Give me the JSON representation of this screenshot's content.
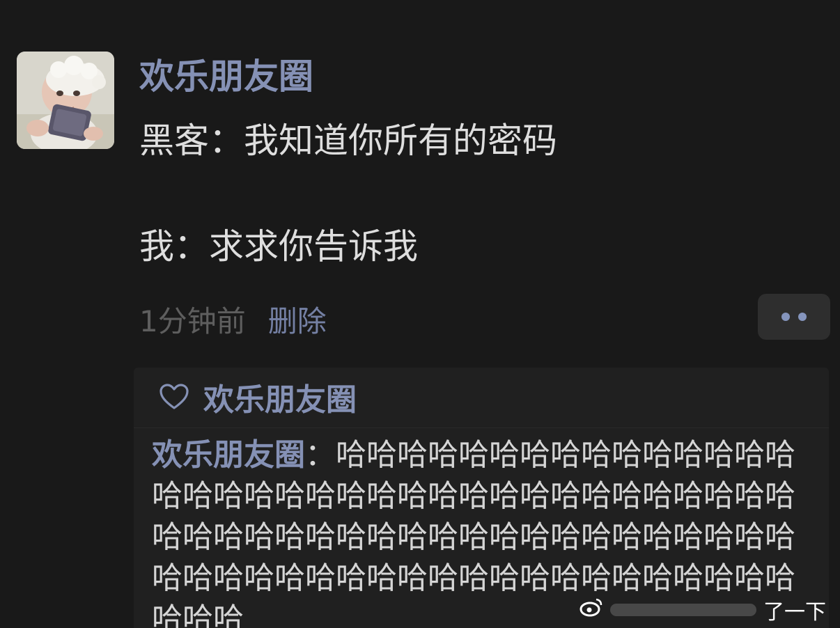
{
  "post": {
    "author": "欢乐朋友圈",
    "lines": [
      "黑客：我知道你所有的密码",
      "我：求求你告诉我"
    ],
    "timestamp": "1分钟前",
    "delete_label": "删除"
  },
  "reactions": {
    "likes": "欢乐朋友圈",
    "comment_author": "欢乐朋友圈",
    "comment_sep": "：",
    "comment_text": "哈哈哈哈哈哈哈哈哈哈哈哈哈哈哈哈哈哈哈哈哈哈哈哈哈哈哈哈哈哈哈哈哈哈哈哈哈哈哈哈哈哈哈哈哈哈哈哈哈哈哈哈哈哈哈哈哈哈哈哈哈哈哈哈哈哈哈哈哈哈哈哈哈哈哈哈哈哈哈哈哈"
  },
  "watermark": {
    "text": "了一下"
  },
  "icons": {
    "like": "heart-outline-icon",
    "more": "more-dots-icon",
    "watermark": "weibo-logo-icon"
  },
  "colors": {
    "background": "#191919",
    "name": "#8591b5",
    "text": "#dedede",
    "meta": "#5e5e5e",
    "panel": "#202020"
  }
}
